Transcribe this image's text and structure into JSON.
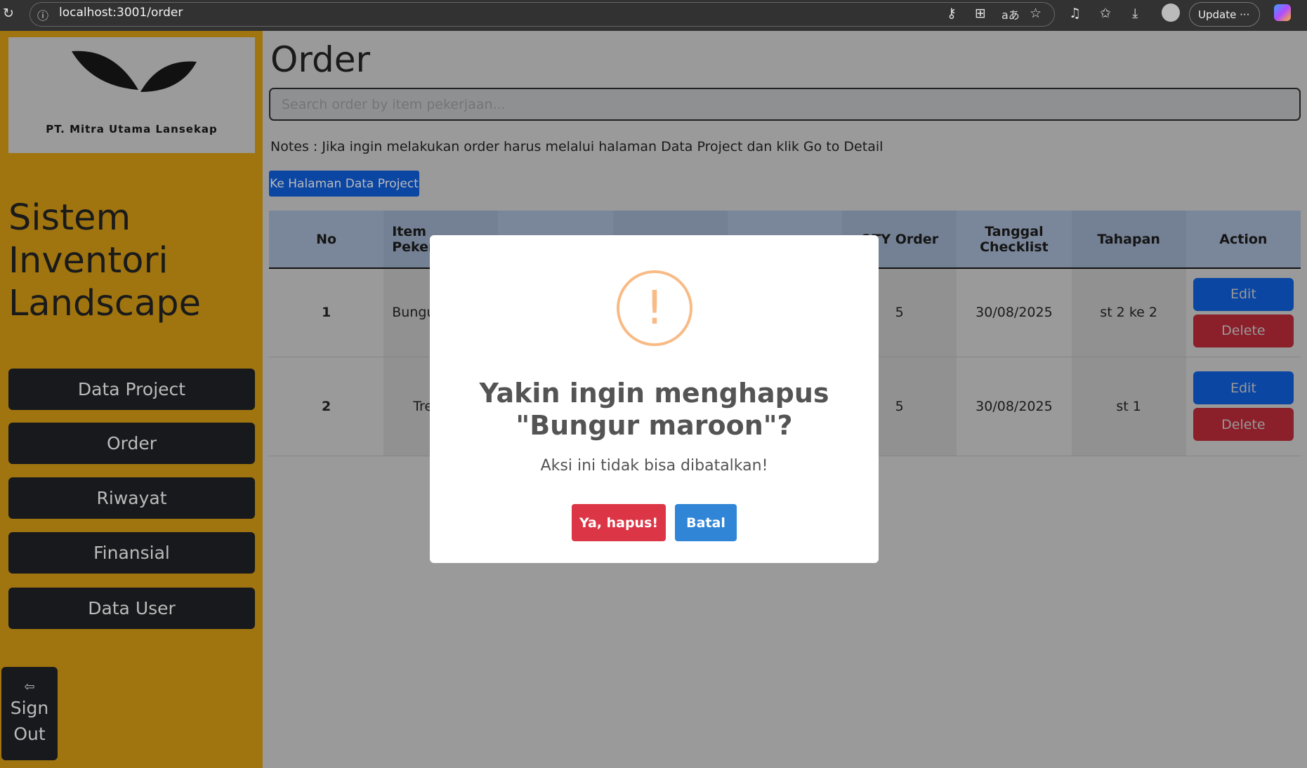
{
  "browser": {
    "url": "localhost:3001/order",
    "update_label": "Update"
  },
  "sidebar": {
    "logo_text": "PT. Mitra Utama Lansekap",
    "title": "Sistem Inventori Landscape",
    "items": [
      {
        "label": "Data Project"
      },
      {
        "label": "Order"
      },
      {
        "label": "Riwayat"
      },
      {
        "label": "Finansial"
      },
      {
        "label": "Data User"
      }
    ],
    "signout_label": "Sign Out"
  },
  "main": {
    "title": "Order",
    "search_placeholder": "Search order by item pekerjaan...",
    "notes": "Notes : Jika ingin melakukan order harus melalui halaman Data Project dan klik Go to Detail",
    "goto_button": "Ke Halaman Data Project",
    "table": {
      "headers": [
        "No",
        "Item Pekerjaan",
        "",
        "",
        "",
        "QTY Order",
        "Tanggal Checklist",
        "Tahapan",
        "Action"
      ],
      "rows": [
        {
          "no": "1",
          "item": "Bungur maroon",
          "qty": "5",
          "tanggal": "30/08/2025",
          "tahapan": "st 2 ke 2"
        },
        {
          "no": "2",
          "item": "Tre",
          "qty": "5",
          "tanggal": "30/08/2025",
          "tahapan": "st 1"
        }
      ],
      "edit_label": "Edit",
      "delete_label": "Delete"
    }
  },
  "modal": {
    "icon": "!",
    "title": "Yakin ingin menghapus \"Bungur maroon\"?",
    "text": "Aksi ini tidak bisa dibatalkan!",
    "confirm": "Ya, hapus!",
    "cancel": "Batal",
    "confirm_color": "#dc3545",
    "cancel_color": "#3085d6"
  }
}
